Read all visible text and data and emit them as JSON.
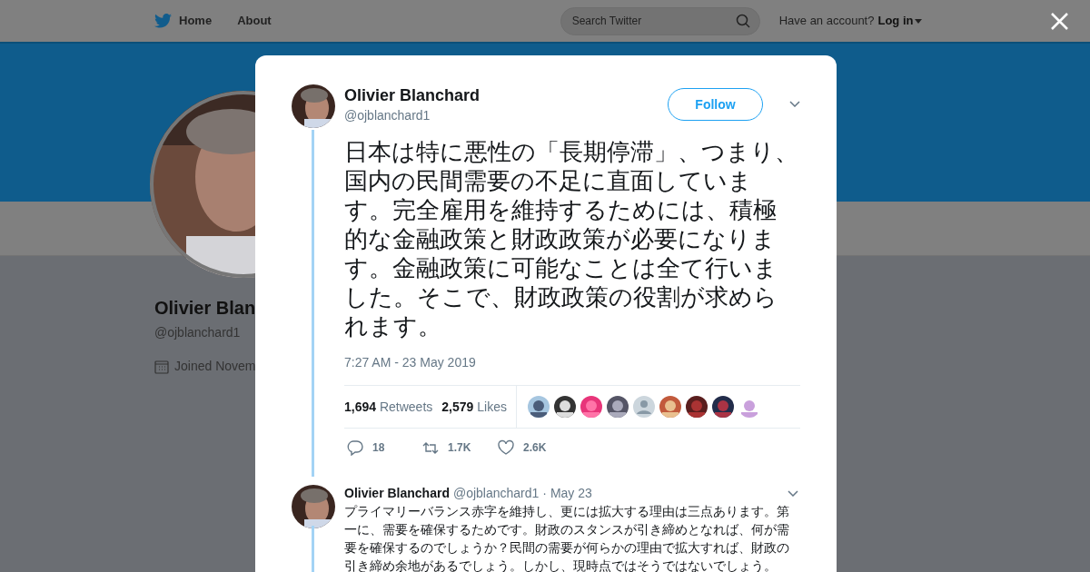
{
  "nav": {
    "items": [
      {
        "label": "Home",
        "kind": "home"
      },
      {
        "label": "About",
        "kind": "plain"
      }
    ],
    "search": {
      "placeholder": "Search Twitter"
    },
    "account_prompt": "Have an account?",
    "login": "Log in"
  },
  "profile": {
    "name": "Olivier Blan",
    "handle": "@ojblanchard1",
    "joined": "Joined Novem"
  },
  "tweet": {
    "author": "Olivier Blanchard",
    "handle": "@ojblanchard1",
    "follow": "Follow",
    "text": "日本は特に悪性の「長期停滞」、つまり、国内の民間需要の不足に直面しています。完全雇用を維持するためには、積極的な金融政策と財政政策が必要になります。金融政策に可能なことは全て行いました。そこで、財政政策の役割が求められます。",
    "timestamp": "7:27 AM - 23 May 2019",
    "retweets_count": "1,694",
    "retweets_label": "Retweets",
    "likes_count": "2,579",
    "likes_label": "Likes",
    "likers": [
      {
        "kind": "picture"
      },
      {
        "kind": "picture"
      },
      {
        "kind": "picture"
      },
      {
        "kind": "picture"
      },
      {
        "kind": "default"
      },
      {
        "kind": "picture"
      },
      {
        "kind": "picture"
      },
      {
        "kind": "picture"
      },
      {
        "kind": "picture"
      }
    ],
    "actions": [
      {
        "kind": "reply",
        "count": "18"
      },
      {
        "kind": "retweet",
        "count": "1.7K"
      },
      {
        "kind": "like",
        "count": "2.6K"
      }
    ]
  },
  "reply": {
    "author": "Olivier Blanchard",
    "handle": "@ojblanchard1",
    "date": "· May 23",
    "text": "プライマリーバランス赤字を維持し、更には拡大する理由は三点あります。第一に、需要を確保するためです。財政のスタンスが引き締めとなれば、何が需要を確保するのでしょうか？民間の需要が何らかの理由で拡大すれば、財政の引き締め余地があるでしょう。しかし、現時点ではそうではないでしょう。"
  }
}
